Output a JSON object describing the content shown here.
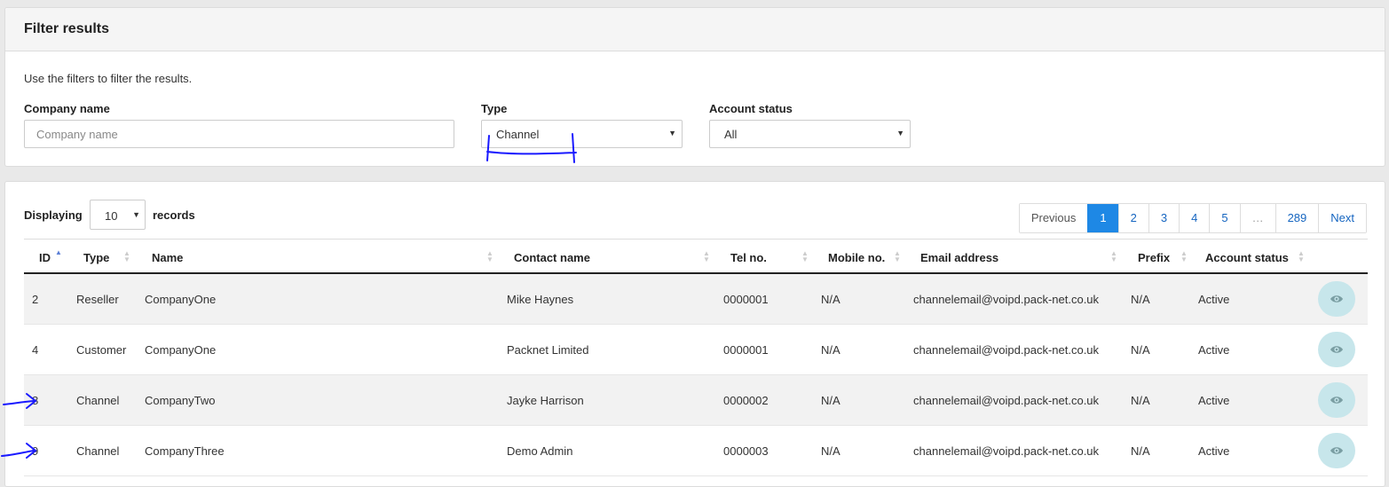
{
  "filter": {
    "title": "Filter results",
    "hint": "Use the filters to filter the results.",
    "company_label": "Company name",
    "company_placeholder": "Company name",
    "type_label": "Type",
    "type_value": "Channel",
    "status_label": "Account status",
    "status_value": "All"
  },
  "results": {
    "displaying": "Displaying",
    "records": "records",
    "page_length": "10",
    "pager": [
      "Previous",
      "1",
      "2",
      "3",
      "4",
      "5",
      "…",
      "289",
      "Next"
    ],
    "active_page": "1",
    "columns": [
      "ID",
      "Type",
      "Name",
      "Contact name",
      "Tel no.",
      "Mobile no.",
      "Email address",
      "Prefix",
      "Account status"
    ],
    "rows": [
      {
        "id": "2",
        "type": "Reseller",
        "name": "CompanyOne",
        "contact": "Mike Haynes",
        "tel": "0000001",
        "mobile": "N/A",
        "email": "channelemail@voipd.pack-net.co.uk",
        "prefix": "N/A",
        "status": "Active"
      },
      {
        "id": "4",
        "type": "Customer",
        "name": "CompanyOne",
        "contact": "Packnet Limited",
        "tel": "0000001",
        "mobile": "N/A",
        "email": "channelemail@voipd.pack-net.co.uk",
        "prefix": "N/A",
        "status": "Active"
      },
      {
        "id": "8",
        "type": "Channel",
        "name": "CompanyTwo",
        "contact": "Jayke Harrison",
        "tel": "0000002",
        "mobile": "N/A",
        "email": "channelemail@voipd.pack-net.co.uk",
        "prefix": "N/A",
        "status": "Active"
      },
      {
        "id": "9",
        "type": "Channel",
        "name": "CompanyThree",
        "contact": "Demo Admin",
        "tel": "0000003",
        "mobile": "N/A",
        "email": "channelemail@voipd.pack-net.co.uk",
        "prefix": "N/A",
        "status": "Active"
      }
    ]
  },
  "icons": {
    "view": "eye-icon",
    "sort": "sort-icon",
    "caret": "chevron-down-icon"
  },
  "colors": {
    "accent": "#1e88e5",
    "view_button": "#c7e6eb",
    "annotation": "#1a1aff"
  }
}
